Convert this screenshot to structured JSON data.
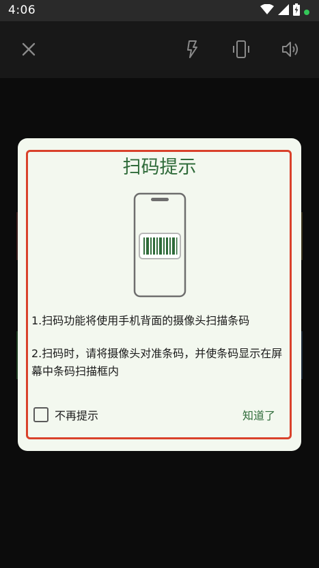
{
  "status_bar": {
    "time": "4:06",
    "icons": [
      "wifi-icon",
      "signal-icon",
      "battery-icon",
      "notification-dot-icon"
    ]
  },
  "toolbar": {
    "icons": [
      "close-icon",
      "flash-icon",
      "vibrate-icon",
      "volume-icon"
    ]
  },
  "dialog": {
    "title": "扫码提示",
    "tip_1": "1.扫码功能将使用手机背面的摄像头扫描条码",
    "tip_2": "2.扫码时，请将摄像头对准条码，并使条码显示在屏幕中条码扫描框内",
    "checkbox_label": "不再提示",
    "checkbox_checked": false,
    "confirm_label": "知道了"
  },
  "colors": {
    "accent": "#2f6b3a",
    "highlight_border": "#d9412a",
    "dialog_bg": "#f3f8ef",
    "status_bar_bg": "#2a2a2a",
    "toolbar_bg": "#181818",
    "background": "#0c0c0c"
  }
}
